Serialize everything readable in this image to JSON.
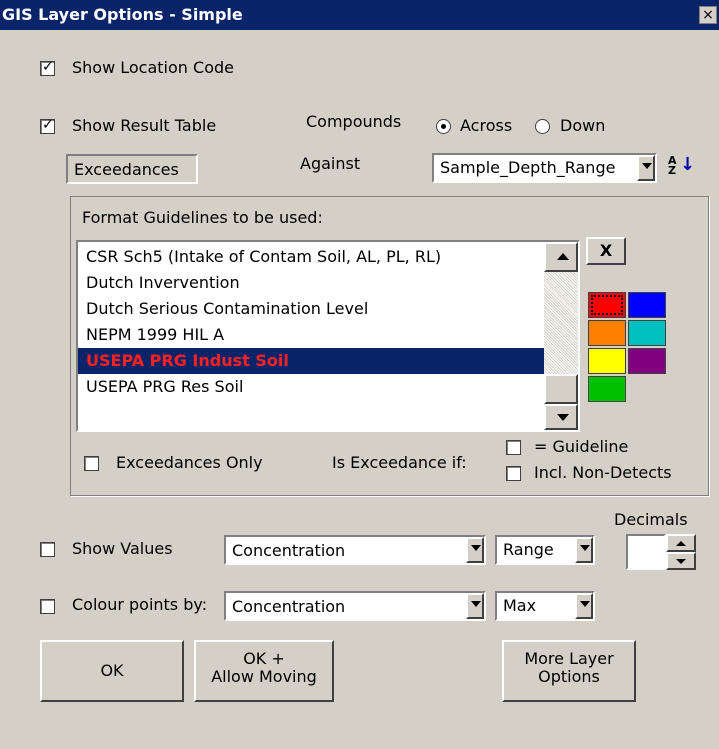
{
  "window": {
    "title": "GIS Layer Options - Simple",
    "close_glyph": "×"
  },
  "checkboxes": {
    "show_location_code": {
      "label": "Show Location Code",
      "checked": true
    },
    "show_result_table": {
      "label": "Show Result Table",
      "checked": true
    },
    "exceedances_only": {
      "label": "Exceedances Only",
      "checked": false
    },
    "eq_guideline": {
      "label": "= Guideline",
      "checked": false
    },
    "incl_non_detects": {
      "label": "Incl. Non-Detects",
      "checked": false
    },
    "show_values": {
      "label": "Show Values",
      "checked": false
    },
    "colour_points": {
      "label": "Colour points by:",
      "checked": false
    }
  },
  "compounds": {
    "label": "Compounds",
    "across": "Across",
    "down": "Down",
    "selected": "Across"
  },
  "exceedances_button": "Exceedances",
  "against": {
    "label": "Against",
    "value": "Sample_Depth_Range"
  },
  "sort_icon": "sort-az-icon",
  "guidelines": {
    "group_label": "Format Guidelines to be used:",
    "items": [
      "CSR Sch5 (Intake of Contam Soil, AL, PL, RL)",
      "Dutch Invervention",
      "Dutch Serious Contamination Level",
      "NEPM 1999 HIL A",
      "USEPA PRG Indust Soil",
      "USEPA PRG Res Soil"
    ],
    "selected_index": 4,
    "delete_label": "X",
    "is_exceedance_label": "Is Exceedance if:"
  },
  "colors": {
    "palette": [
      "#ff0000",
      "#0000ff",
      "#ff8000",
      "#00c0c0",
      "#ffff00",
      "#800080",
      "#00c000"
    ],
    "title_bar": "#0a246a",
    "selection_text": "#ff2020"
  },
  "decimals": {
    "label": "Decimals",
    "value": ""
  },
  "show_values_row": {
    "field": "Concentration",
    "mode": "Range"
  },
  "colour_row": {
    "field": "Concentration",
    "mode": "Max"
  },
  "buttons": {
    "ok": "OK",
    "ok_allow_line1": "OK +",
    "ok_allow_line2": "Allow Moving",
    "more_line1": "More Layer",
    "more_line2": "Options"
  }
}
